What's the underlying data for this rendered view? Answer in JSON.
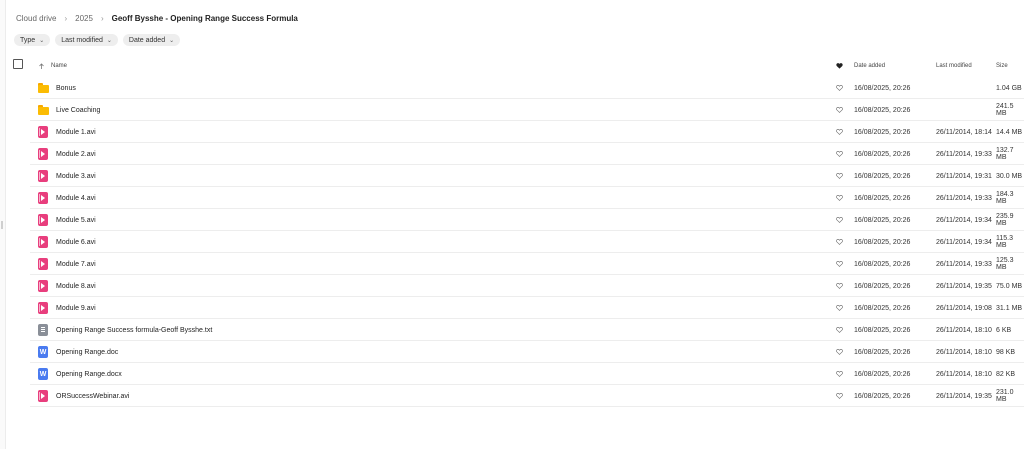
{
  "breadcrumb": {
    "items": [
      "Cloud drive",
      "2025"
    ],
    "current": "Geoff Bysshe - Opening Range Success Formula"
  },
  "filters": [
    {
      "label": "Type"
    },
    {
      "label": "Last modified"
    },
    {
      "label": "Date added"
    }
  ],
  "header": {
    "name": "Name",
    "date_added": "Date added",
    "last_modified": "Last modified",
    "size": "Size"
  },
  "files": [
    {
      "name": "Bonus",
      "type": "folder",
      "added": "16/08/2025, 20:26",
      "modified": "",
      "size": "1.04 GB"
    },
    {
      "name": "Live Coaching",
      "type": "folder",
      "added": "16/08/2025, 20:26",
      "modified": "",
      "size": "241.5 MB"
    },
    {
      "name": "Module 1.avi",
      "type": "video",
      "added": "16/08/2025, 20:26",
      "modified": "26/11/2014, 18:14",
      "size": "14.4 MB"
    },
    {
      "name": "Module 2.avi",
      "type": "video",
      "added": "16/08/2025, 20:26",
      "modified": "26/11/2014, 19:33",
      "size": "132.7 MB"
    },
    {
      "name": "Module 3.avi",
      "type": "video",
      "added": "16/08/2025, 20:26",
      "modified": "26/11/2014, 19:31",
      "size": "30.0 MB"
    },
    {
      "name": "Module 4.avi",
      "type": "video",
      "added": "16/08/2025, 20:26",
      "modified": "26/11/2014, 19:33",
      "size": "184.3 MB"
    },
    {
      "name": "Module 5.avi",
      "type": "video",
      "added": "16/08/2025, 20:26",
      "modified": "26/11/2014, 19:34",
      "size": "235.9 MB"
    },
    {
      "name": "Module 6.avi",
      "type": "video",
      "added": "16/08/2025, 20:26",
      "modified": "26/11/2014, 19:34",
      "size": "115.3 MB"
    },
    {
      "name": "Module 7.avi",
      "type": "video",
      "added": "16/08/2025, 20:26",
      "modified": "26/11/2014, 19:33",
      "size": "125.3 MB"
    },
    {
      "name": "Module 8.avi",
      "type": "video",
      "added": "16/08/2025, 20:26",
      "modified": "26/11/2014, 19:35",
      "size": "75.0 MB"
    },
    {
      "name": "Module 9.avi",
      "type": "video",
      "added": "16/08/2025, 20:26",
      "modified": "26/11/2014, 19:08",
      "size": "31.1 MB"
    },
    {
      "name": "Opening Range Success formula-Geoff Bysshe.txt",
      "type": "text",
      "added": "16/08/2025, 20:26",
      "modified": "26/11/2014, 18:10",
      "size": "6 KB"
    },
    {
      "name": "Opening Range.doc",
      "type": "word",
      "icon_letter": "W",
      "added": "16/08/2025, 20:26",
      "modified": "26/11/2014, 18:10",
      "size": "98 KB"
    },
    {
      "name": "Opening Range.docx",
      "type": "word",
      "icon_letter": "W",
      "added": "16/08/2025, 20:26",
      "modified": "26/11/2014, 18:10",
      "size": "82 KB"
    },
    {
      "name": "ORSuccessWebinar.avi",
      "type": "video",
      "added": "16/08/2025, 20:26",
      "modified": "26/11/2014, 19:35",
      "size": "231.0 MB"
    }
  ],
  "colors": {
    "folder": "#fbbc04",
    "video": "#e83e7d",
    "text": "#8a8f98",
    "word": "#4a7bf0"
  },
  "icons": {
    "sort": "arrow-up-icon",
    "favourite": "heart-icon",
    "chevron": "chevron-down-icon"
  }
}
